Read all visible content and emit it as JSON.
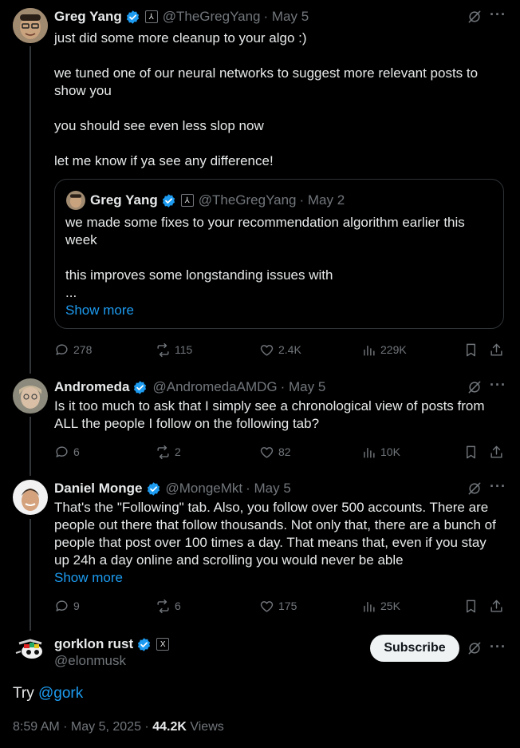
{
  "tweets": [
    {
      "name": "Greg Yang",
      "handle": "@TheGregYang",
      "date": "· May 5",
      "affiliate": "xAI",
      "text": "just did some more cleanup to your algo :)\n\nwe tuned one of our neural networks to suggest more relevant posts to show you\n\nyou should see even less slop now\n\nlet me know if ya see any difference!",
      "quote": {
        "name": "Greg Yang",
        "handle": "@TheGregYang",
        "date": "· May 2",
        "text": "we made some fixes to your recommendation algorithm earlier this week\n\nthis improves some longstanding issues with\n...",
        "show_more": "Show more"
      },
      "replies": "278",
      "reposts": "115",
      "likes": "2.4K",
      "views": "229K"
    },
    {
      "name": "Andromeda",
      "handle": "@AndromedaAMDG",
      "date": "· May 5",
      "text": "Is it too much to ask that I simply see a chronological view of posts from ALL the people I follow on the following tab?",
      "replies": "6",
      "reposts": "2",
      "likes": "82",
      "views": "10K"
    },
    {
      "name": "Daniel Monge",
      "handle": "@MongeMkt",
      "date": "· May 5",
      "text": "That's the \"Following\" tab. Also, you follow over 500 accounts. There are people out there that follow thousands. Not only that, there are a bunch of people that post over 100 times a day. That means that, even if you stay up 24h a day online and scrolling you would never be able",
      "show_more": "Show more",
      "replies": "9",
      "reposts": "6",
      "likes": "175",
      "views": "25K"
    }
  ],
  "main": {
    "name": "gorklon rust",
    "handle": "@elonmusk",
    "affiliate": "X",
    "subscribe": "Subscribe",
    "text_prefix": "Try ",
    "mention": "@gork",
    "time": "8:59 AM · May 5, 2025 · ",
    "views_count": "44.2K",
    "views_label": " Views"
  },
  "colors": {
    "accent": "#1d9bf0",
    "muted": "#71767b",
    "text": "#e7e9ea",
    "background": "#000000"
  }
}
